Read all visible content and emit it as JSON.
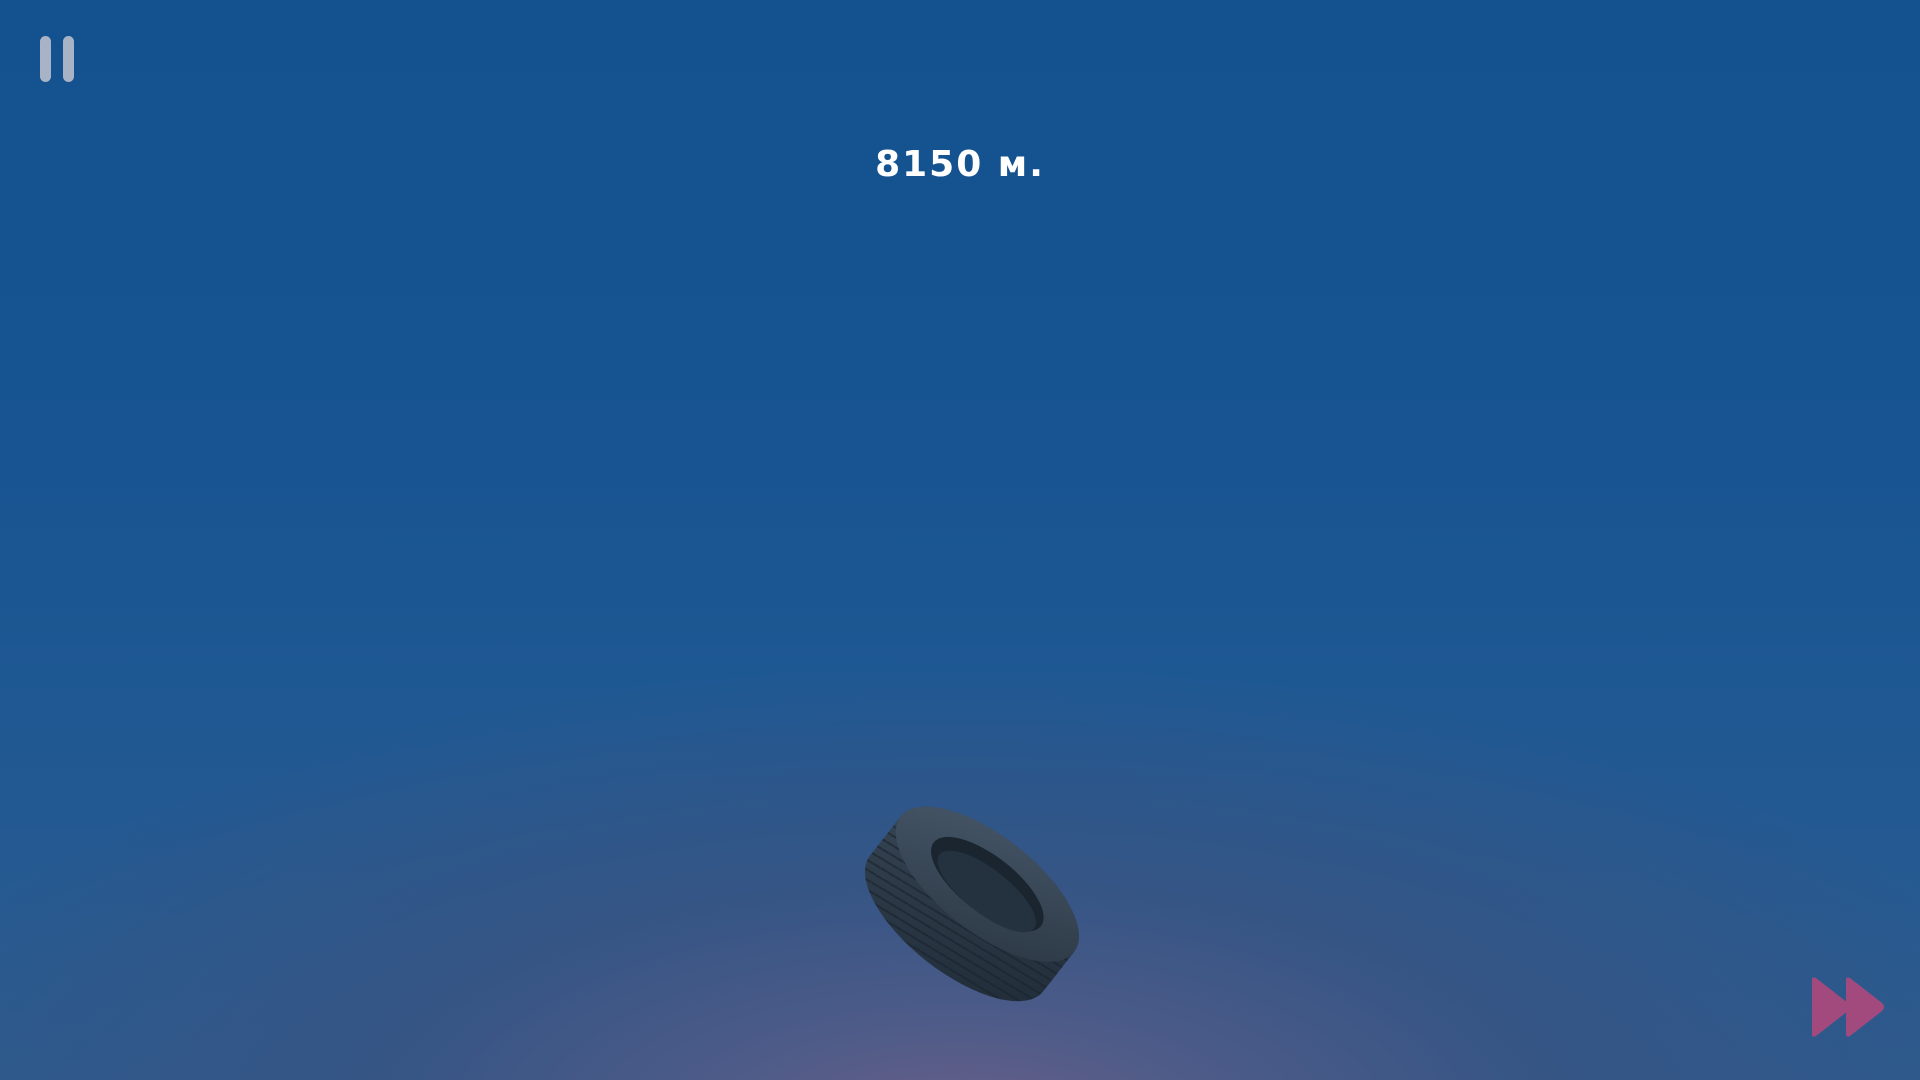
{
  "hud": {
    "distance_text": "8150 м."
  },
  "icons": {
    "pause": "pause-icon",
    "fast_forward": "fast-forward-icon",
    "player": "tire-icon"
  },
  "colors": {
    "sky_top": "#13528f",
    "sky_bottom_glow": "#6a5f88",
    "pause_icon": "#a9b3c6",
    "fast_forward_icon": "#a24a7e",
    "distance_text": "#ffffff"
  }
}
